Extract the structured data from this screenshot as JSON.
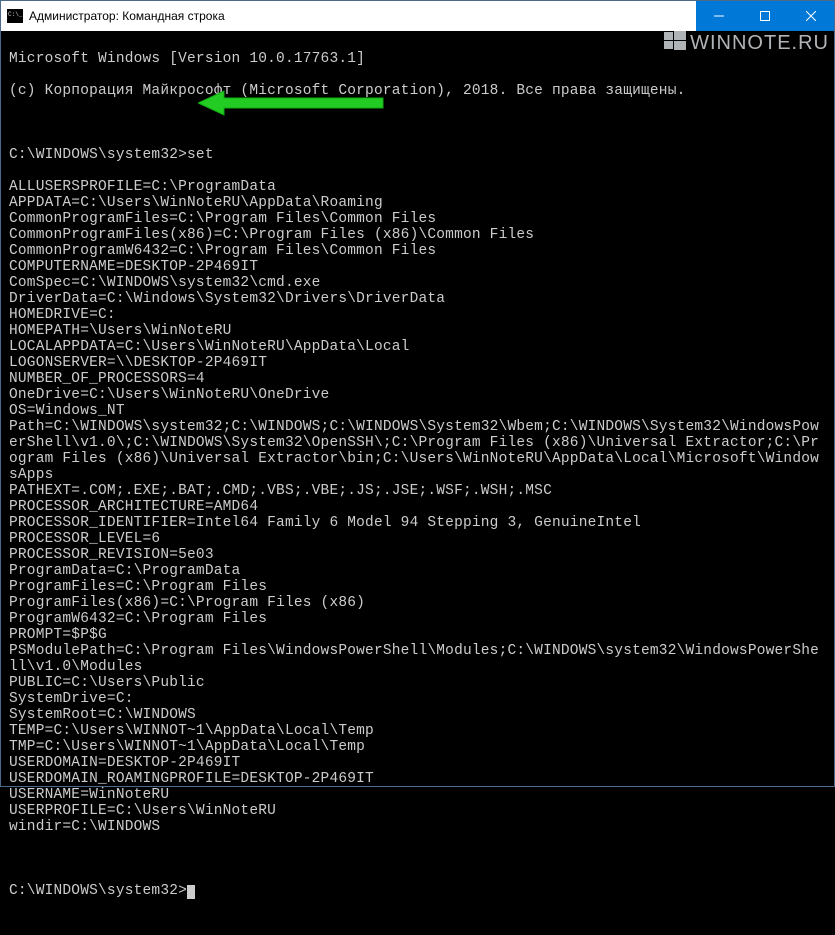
{
  "window": {
    "title": "Администратор: Командная строка"
  },
  "watermark": {
    "text": "WINNOTE.RU"
  },
  "terminal": {
    "header1": "Microsoft Windows [Version 10.0.17763.1]",
    "header2": "(c) Корпорация Майкрософт (Microsoft Corporation), 2018. Все права защищены.",
    "prompt1_path": "C:\\WINDOWS\\system32>",
    "prompt1_cmd": "set",
    "env": [
      "ALLUSERSPROFILE=C:\\ProgramData",
      "APPDATA=C:\\Users\\WinNoteRU\\AppData\\Roaming",
      "CommonProgramFiles=C:\\Program Files\\Common Files",
      "CommonProgramFiles(x86)=C:\\Program Files (x86)\\Common Files",
      "CommonProgramW6432=C:\\Program Files\\Common Files",
      "COMPUTERNAME=DESKTOP-2P469IT",
      "ComSpec=C:\\WINDOWS\\system32\\cmd.exe",
      "DriverData=C:\\Windows\\System32\\Drivers\\DriverData",
      "HOMEDRIVE=C:",
      "HOMEPATH=\\Users\\WinNoteRU",
      "LOCALAPPDATA=C:\\Users\\WinNoteRU\\AppData\\Local",
      "LOGONSERVER=\\\\DESKTOP-2P469IT",
      "NUMBER_OF_PROCESSORS=4",
      "OneDrive=C:\\Users\\WinNoteRU\\OneDrive",
      "OS=Windows_NT",
      "Path=C:\\WINDOWS\\system32;C:\\WINDOWS;C:\\WINDOWS\\System32\\Wbem;C:\\WINDOWS\\System32\\WindowsPowerShell\\v1.0\\;C:\\WINDOWS\\System32\\OpenSSH\\;C:\\Program Files (x86)\\Universal Extractor;C:\\Program Files (x86)\\Universal Extractor\\bin;C:\\Users\\WinNoteRU\\AppData\\Local\\Microsoft\\WindowsApps",
      "PATHEXT=.COM;.EXE;.BAT;.CMD;.VBS;.VBE;.JS;.JSE;.WSF;.WSH;.MSC",
      "PROCESSOR_ARCHITECTURE=AMD64",
      "PROCESSOR_IDENTIFIER=Intel64 Family 6 Model 94 Stepping 3, GenuineIntel",
      "PROCESSOR_LEVEL=6",
      "PROCESSOR_REVISION=5e03",
      "ProgramData=C:\\ProgramData",
      "ProgramFiles=C:\\Program Files",
      "ProgramFiles(x86)=C:\\Program Files (x86)",
      "ProgramW6432=C:\\Program Files",
      "PROMPT=$P$G",
      "PSModulePath=C:\\Program Files\\WindowsPowerShell\\Modules;C:\\WINDOWS\\system32\\WindowsPowerShell\\v1.0\\Modules",
      "PUBLIC=C:\\Users\\Public",
      "SystemDrive=C:",
      "SystemRoot=C:\\WINDOWS",
      "TEMP=C:\\Users\\WINNOT~1\\AppData\\Local\\Temp",
      "TMP=C:\\Users\\WINNOT~1\\AppData\\Local\\Temp",
      "USERDOMAIN=DESKTOP-2P469IT",
      "USERDOMAIN_ROAMINGPROFILE=DESKTOP-2P469IT",
      "USERNAME=WinNoteRU",
      "USERPROFILE=C:\\Users\\WinNoteRU",
      "windir=C:\\WINDOWS"
    ],
    "prompt2": "C:\\WINDOWS\\system32>"
  }
}
